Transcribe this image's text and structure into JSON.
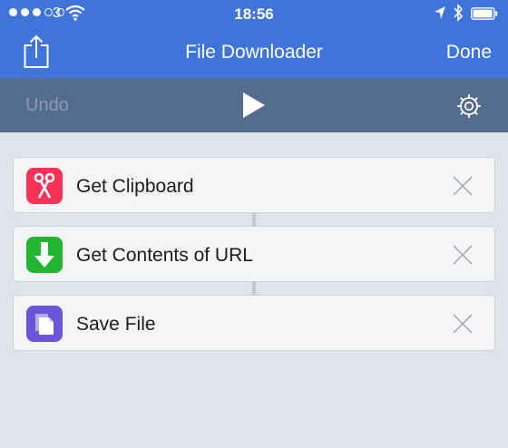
{
  "status_bar": {
    "carrier": "3",
    "time": "18:56",
    "icons": [
      "signal-dots",
      "wifi-icon",
      "location-arrow-icon",
      "bluetooth-icon",
      "battery-icon"
    ]
  },
  "nav": {
    "title": "File Downloader",
    "done_label": "Done",
    "share_icon": "share-icon"
  },
  "toolbar": {
    "undo_label": "Undo",
    "play_icon": "play-icon",
    "settings_icon": "gear-icon"
  },
  "actions": [
    {
      "label": "Get Clipboard",
      "icon": "scissors-icon",
      "color": "#fc3158"
    },
    {
      "label": "Get Contents of URL",
      "icon": "download-arrow-icon",
      "color": "#22b52f"
    },
    {
      "label": "Save File",
      "icon": "file-icon",
      "color": "#6a55d9"
    }
  ],
  "colors": {
    "nav_bar": "#3f74da",
    "toolbar": "#546c8e",
    "background": "#dfe3ea"
  }
}
